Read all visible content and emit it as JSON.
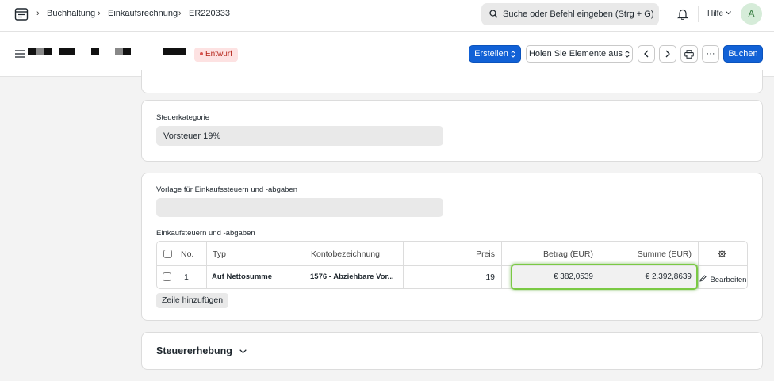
{
  "navbar": {
    "breadcrumbs": [
      "Buchhaltung",
      "Einkaufsrechnung",
      "ER220333"
    ],
    "search_placeholder": "Suche oder Befehl eingeben (Strg + G)",
    "help_label": "Hilfe",
    "avatar_initial": "A"
  },
  "pagehead": {
    "status": "Entwurf",
    "create_label": "Erstellen",
    "get_items_label": "Holen Sie Elemente aus",
    "more_label": "···",
    "submit_label": "Buchen"
  },
  "tax_category": {
    "label": "Steuerkategorie",
    "value": "Vorsteuer 19%"
  },
  "taxes": {
    "template_label": "Vorlage für Einkaufssteuern und -abgaben",
    "template_value": "",
    "table_label": "Einkaufsteuern und -abgaben",
    "columns": {
      "no": "No.",
      "type": "Typ",
      "account": "Kontobezeichnung",
      "rate": "Preis",
      "amount": "Betrag (EUR)",
      "total": "Summe (EUR)"
    },
    "rows": [
      {
        "no": "1",
        "type": "Auf Nettosumme",
        "account": "1576 - Abziehbare Vor...",
        "rate": "19",
        "amount": "€ 382,0539",
        "total": "€ 2.392,8639",
        "edit_label": "Bearbeiten"
      }
    ],
    "add_row_label": "Zeile hinzufügen"
  },
  "section": {
    "title": "Steuererhebung"
  }
}
